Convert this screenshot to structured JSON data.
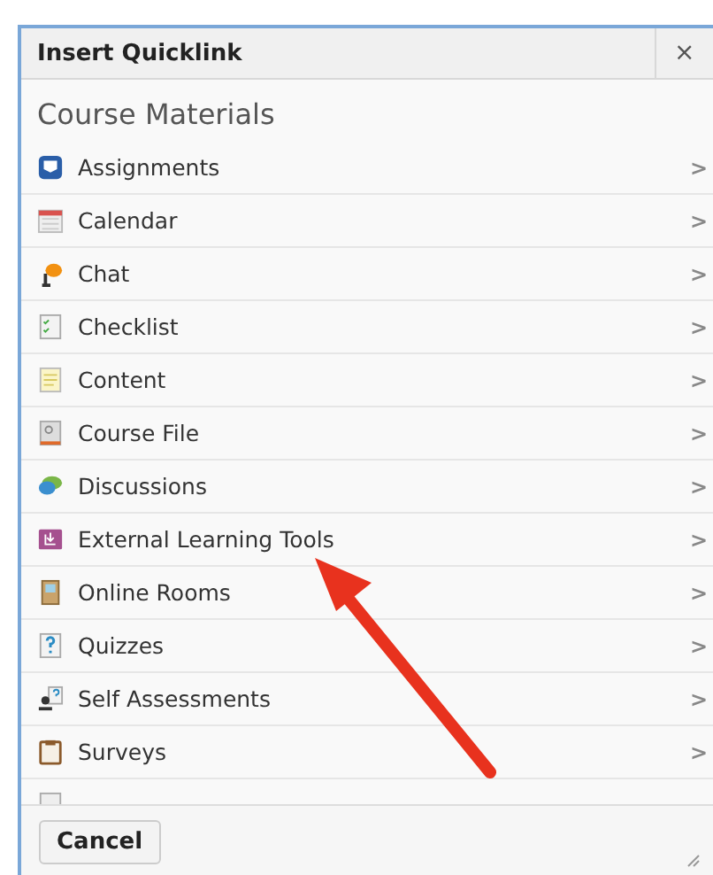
{
  "dialog": {
    "title": "Insert Quicklink",
    "close": "×"
  },
  "section": {
    "heading": "Course Materials"
  },
  "items": [
    {
      "kind": "link",
      "label": "Assignments",
      "chevron": ">"
    },
    {
      "kind": "link",
      "label": "Calendar",
      "chevron": ">"
    },
    {
      "kind": "link",
      "label": "Chat",
      "chevron": ">"
    },
    {
      "kind": "link",
      "label": "Checklist",
      "chevron": ">"
    },
    {
      "kind": "link",
      "label": "Content",
      "chevron": ">"
    },
    {
      "kind": "link",
      "label": "Course File",
      "chevron": ">"
    },
    {
      "kind": "link",
      "label": "Discussions",
      "chevron": ">"
    },
    {
      "kind": "link",
      "label": "External Learning Tools",
      "chevron": ">"
    },
    {
      "kind": "link",
      "label": "Online Rooms",
      "chevron": ">"
    },
    {
      "kind": "link",
      "label": "Quizzes",
      "chevron": ">"
    },
    {
      "kind": "link",
      "label": "Self Assessments",
      "chevron": ">"
    },
    {
      "kind": "link",
      "label": "Surveys",
      "chevron": ">"
    },
    {
      "kind": "cut_off"
    }
  ],
  "footer": {
    "buttons": [
      "Cancel"
    ]
  }
}
